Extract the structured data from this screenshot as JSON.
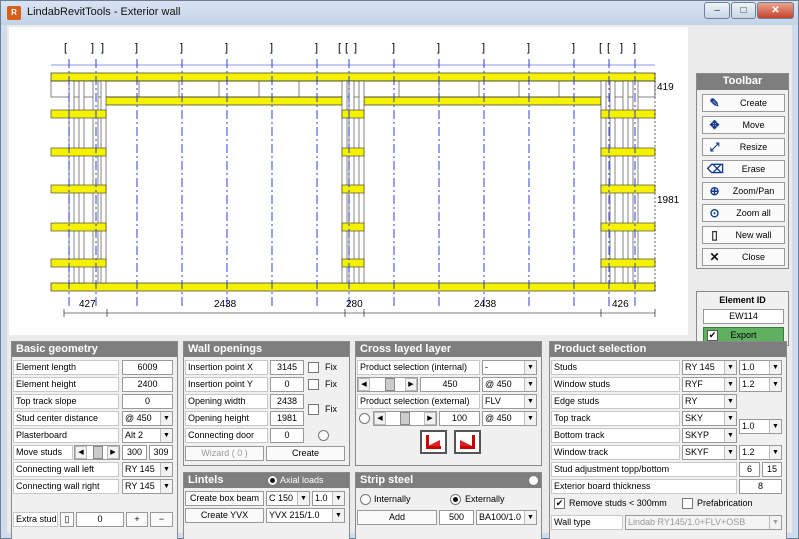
{
  "window": {
    "title": "LindabRevitTools - Exterior wall",
    "icon": "revit-app-icon",
    "min": "–",
    "max": "□",
    "close": "✕"
  },
  "drawing": {
    "labels": {
      "top_thickness": "419",
      "height": "1981"
    },
    "dims": [
      "427",
      "2438",
      "280",
      "2438",
      "426"
    ]
  },
  "toolbar": {
    "title": "Toolbar",
    "items": [
      {
        "label": "Create",
        "icon": "create-icon"
      },
      {
        "label": "Move",
        "icon": "move-icon"
      },
      {
        "label": "Resize",
        "icon": "resize-icon"
      },
      {
        "label": "Erase",
        "icon": "erase-icon"
      },
      {
        "label": "Zoom/Pan",
        "icon": "zoom-pan-icon"
      },
      {
        "label": "Zoom all",
        "icon": "zoom-all-icon"
      },
      {
        "label": "New wall",
        "icon": "new-wall-icon"
      },
      {
        "label": "Close",
        "icon": "close-icon"
      }
    ]
  },
  "element": {
    "title": "Element ID",
    "id": "EW114",
    "export": "Export",
    "export_checked": "✔"
  },
  "basic": {
    "title": "Basic geometry",
    "length_label": "Element length",
    "length": "6009",
    "height_label": "Element height",
    "height": "2400",
    "slope_label": "Top track slope",
    "slope": "0",
    "stud_dist_label": "Stud center distance",
    "stud_dist": "@ 450",
    "plaster_label": "Plasterboard",
    "plaster": "Alt 2",
    "move_label": "Move studs",
    "move_a": "300",
    "move_b": "309",
    "conn_left_label": "Connecting wall left",
    "conn_left": "RY 145",
    "conn_right_label": "Connecting wall right",
    "conn_right": "RY 145",
    "extra_label": "Extra stud",
    "extra_val": "0",
    "plus": "+",
    "minus": "−"
  },
  "openings": {
    "title": "Wall openings",
    "ix_label": "Insertion point X",
    "ix": "3145",
    "fix": "Fix",
    "iy_label": "Insertion point Y",
    "iy": "0",
    "w_label": "Opening width",
    "w": "2438",
    "h_label": "Opening height",
    "h": "1981",
    "door_label": "Connecting door",
    "door": "0",
    "wizard": "Wizard ( 0 )",
    "create": "Create"
  },
  "lintels": {
    "title": "Lintels",
    "axial": "Axial loads",
    "box_beam": "Create box beam",
    "box_sel": "C 150",
    "box_sel2": "1.0",
    "yvx": "Create YVX",
    "yvx_sel": "YVX 215/1.0"
  },
  "cross": {
    "title": "Cross layed layer",
    "int_label": "Product selection (internal)",
    "int": "-",
    "int_val": "450",
    "int_at": "@ 450",
    "ext_label": "Product selection (external)",
    "ext": "FLV",
    "ext_val": "100",
    "ext_at": "@ 450"
  },
  "strip": {
    "title": "Strip steel",
    "internally": "Internally",
    "externally": "Externally",
    "add": "Add",
    "amount": "500",
    "type": "BA100/1.0"
  },
  "product": {
    "title": "Product selection",
    "rows": [
      {
        "label": "Studs",
        "a": "RY 145",
        "b": "1.0"
      },
      {
        "label": "Window studs",
        "a": "RYF",
        "b": "1.2"
      },
      {
        "label": "Edge studs",
        "a": "RY",
        "b": ""
      },
      {
        "label": "Top track",
        "a": "SKY",
        "b": ""
      },
      {
        "label": "Bottom track",
        "a": "SKYP",
        "b": "1.0"
      },
      {
        "label": "Window track",
        "a": "SKYF",
        "b": "1.2"
      }
    ],
    "adj_label": "Stud adjustment topp/bottom",
    "adj_a": "6",
    "adj_b": "15",
    "ext_board_label": "Exterior board thickness",
    "ext_board": "8",
    "remove_label": "Remove studs < 300mm",
    "prefab_label": "Prefabrication",
    "wall_type_label": "Wall type",
    "wall_type": "Lindab RY145/1.0+FLV+OSB"
  }
}
